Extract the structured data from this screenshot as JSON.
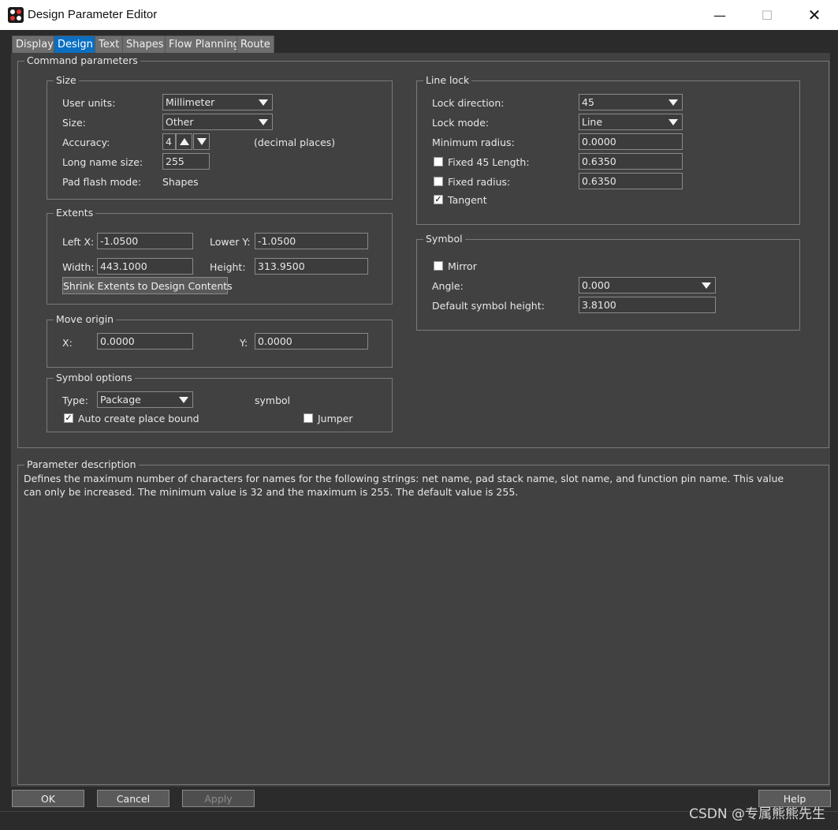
{
  "window": {
    "title": "Design Parameter Editor",
    "icons": {
      "minimize": "—",
      "maximize": "☐",
      "close": "✕"
    }
  },
  "tabs": [
    {
      "label": "Display",
      "active": false
    },
    {
      "label": "Design",
      "active": true
    },
    {
      "label": "Text",
      "active": false
    },
    {
      "label": "Shapes",
      "active": false
    },
    {
      "label": "Flow Planning",
      "active": false
    },
    {
      "label": "Route",
      "active": false
    }
  ],
  "command_parameters": {
    "title": "Command parameters",
    "size": {
      "title": "Size",
      "user_units_label": "User units:",
      "user_units_value": "Millimeter",
      "size_label": "Size:",
      "size_value": "Other",
      "accuracy_label": "Accuracy:",
      "accuracy_value": "4",
      "decimal_places": "(decimal places)",
      "long_name_label": "Long name size:",
      "long_name_value": "255",
      "pad_flash_label": "Pad flash mode:",
      "pad_flash_value": "Shapes"
    },
    "extents": {
      "title": "Extents",
      "left_x_label": "Left X:",
      "left_x_value": "-1.0500",
      "lower_y_label": "Lower Y:",
      "lower_y_value": "-1.0500",
      "width_label": "Width:",
      "width_value": "443.1000",
      "height_label": "Height:",
      "height_value": "313.9500",
      "shrink_button": "Shrink Extents to Design Contents"
    },
    "move_origin": {
      "title": "Move origin",
      "x_label": "X:",
      "x_value": "0.0000",
      "y_label": "Y:",
      "y_value": "0.0000"
    },
    "symbol_options": {
      "title": "Symbol options",
      "type_label": "Type:",
      "type_value": "Package",
      "symbol_text": "symbol",
      "auto_create_label": "Auto create place bound",
      "auto_create_checked": true,
      "jumper_label": "Jumper",
      "jumper_checked": false
    },
    "line_lock": {
      "title": "Line lock",
      "lock_direction_label": "Lock direction:",
      "lock_direction_value": "45",
      "lock_mode_label": "Lock mode:",
      "lock_mode_value": "Line",
      "min_radius_label": "Minimum radius:",
      "min_radius_value": "0.0000",
      "fixed45_label": "Fixed 45 Length:",
      "fixed45_checked": false,
      "fixed45_value": "0.6350",
      "fixed_radius_label": "Fixed radius:",
      "fixed_radius_checked": false,
      "fixed_radius_value": "0.6350",
      "tangent_label": "Tangent",
      "tangent_checked": true
    },
    "symbol": {
      "title": "Symbol",
      "mirror_label": "Mirror",
      "mirror_checked": false,
      "angle_label": "Angle:",
      "angle_value": "0.000",
      "default_height_label": "Default symbol height:",
      "default_height_value": "3.8100"
    }
  },
  "parameter_description": {
    "title": "Parameter description",
    "text": "Defines the maximum number of characters for names for the following strings: net name, pad stack name, slot name, and function pin name. This value can only be increased. The minimum value is 32 and the maximum is 255. The default value is 255."
  },
  "buttons": {
    "ok": "OK",
    "cancel": "Cancel",
    "apply": "Apply",
    "help": "Help"
  },
  "watermark": "CSDN @专属熊熊先生",
  "colors": {
    "panel_bg": "#414141",
    "outer_bg": "#2b2b2b",
    "active_tab": "#0a6fc2",
    "inactive_tab": "#6e6e6e"
  }
}
